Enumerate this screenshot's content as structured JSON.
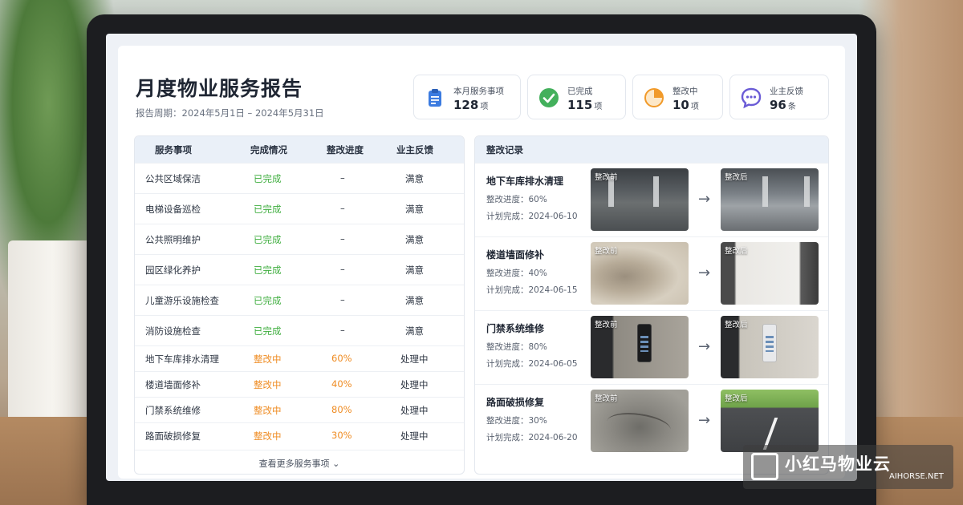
{
  "header": {
    "title": "月度物业服务报告",
    "period_label": "报告周期：",
    "period_value": "2024年5月1日 – 2024年5月31日"
  },
  "stats": [
    {
      "label": "本月服务事项",
      "value": "128",
      "unit": "项",
      "icon": "clipboard-icon",
      "color": "#3b7be0"
    },
    {
      "label": "已完成",
      "value": "115",
      "unit": "项",
      "icon": "check-circle-icon",
      "color": "#43b05c"
    },
    {
      "label": "整改中",
      "value": "10",
      "unit": "项",
      "icon": "pie-progress-icon",
      "color": "#f19a2a"
    },
    {
      "label": "业主反馈",
      "value": "96",
      "unit": "条",
      "icon": "chat-bubble-icon",
      "color": "#6a5bd6"
    }
  ],
  "table": {
    "headers": [
      "服务事项",
      "完成情况",
      "整改进度",
      "业主反馈"
    ],
    "rows": [
      {
        "item": "公共区域保洁",
        "status": "已完成",
        "progress": "–",
        "feedback": "满意",
        "state": "done"
      },
      {
        "item": "电梯设备巡检",
        "status": "已完成",
        "progress": "–",
        "feedback": "满意",
        "state": "done"
      },
      {
        "item": "公共照明维护",
        "status": "已完成",
        "progress": "–",
        "feedback": "满意",
        "state": "done"
      },
      {
        "item": "园区绿化养护",
        "status": "已完成",
        "progress": "–",
        "feedback": "满意",
        "state": "done"
      },
      {
        "item": "儿童游乐设施检查",
        "status": "已完成",
        "progress": "–",
        "feedback": "满意",
        "state": "done"
      },
      {
        "item": "消防设施检查",
        "status": "已完成",
        "progress": "–",
        "feedback": "满意",
        "state": "done"
      },
      {
        "item": "地下车库排水清理",
        "status": "整改中",
        "progress": "60%",
        "feedback": "处理中",
        "state": "fix"
      },
      {
        "item": "楼道墙面修补",
        "status": "整改中",
        "progress": "40%",
        "feedback": "处理中",
        "state": "fix"
      },
      {
        "item": "门禁系统维修",
        "status": "整改中",
        "progress": "80%",
        "feedback": "处理中",
        "state": "fix"
      },
      {
        "item": "路面破损修复",
        "status": "整改中",
        "progress": "30%",
        "feedback": "处理中",
        "state": "fix"
      }
    ],
    "more_label": "查看更多服务事项 ⌄"
  },
  "records": {
    "title": "整改记录",
    "before_tag": "整改前",
    "after_tag": "整改后",
    "items": [
      {
        "name": "地下车库排水清理",
        "progress": "整改进度：60%",
        "plan": "计划完成：2024-06-10",
        "photo": "garage"
      },
      {
        "name": "楼道墙面修补",
        "progress": "整改进度：40%",
        "plan": "计划完成：2024-06-15",
        "photo": "wall"
      },
      {
        "name": "门禁系统维修",
        "progress": "整改进度：80%",
        "plan": "计划完成：2024-06-05",
        "photo": "door"
      },
      {
        "name": "路面破损修复",
        "progress": "整改进度：30%",
        "plan": "计划完成：2024-06-20",
        "photo": "road"
      }
    ]
  },
  "watermark": {
    "brand_cn": "小红马物业云",
    "brand_en": "AIHORSE.NET"
  },
  "colors": {
    "done": "#3fae3f",
    "fix": "#ef8c23",
    "header_bg": "#eaf0f8"
  }
}
